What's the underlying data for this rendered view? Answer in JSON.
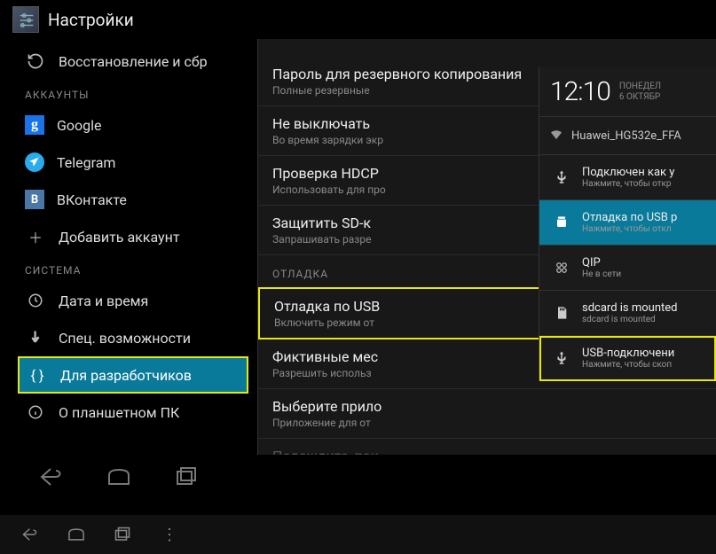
{
  "header": {
    "title": "Настройки"
  },
  "sidebar": {
    "restore": "Восстановление и сбр",
    "section_accounts": "АККАУНТЫ",
    "google": "Google",
    "telegram": "Telegram",
    "vk": "ВКонтакте",
    "add_account": "Добавить аккаунт",
    "section_system": "СИСТЕМА",
    "datetime": "Дата и время",
    "accessibility": "Спец. возможности",
    "developer": "Для разработчиков",
    "about": "О планшетном ПК"
  },
  "main": {
    "backup_pwd": {
      "pri": "Пароль для резервного копирования",
      "sec": "Полные резервные"
    },
    "stay_awake": {
      "pri": "Не выключать",
      "sec": "Во время зарядки экр"
    },
    "hdcp": {
      "pri": "Проверка HDCP",
      "sec": "Использовать для про"
    },
    "protect_sd": {
      "pri": "Защитить SD-к",
      "sec": "Запрашивать разре"
    },
    "section_debug": "ОТЛАДКА",
    "usb_debug": {
      "pri": "Отладка по USB",
      "sec": "Включить режим от"
    },
    "fake_loc": {
      "pri": "Фиктивные мес",
      "sec": "Разрешить использ"
    },
    "select_app": {
      "pri": "Выберите прило",
      "sec": "Приложение для от"
    },
    "wait_dbg": {
      "pri": "Подождите, пок"
    }
  },
  "notif": {
    "time": "12:10",
    "day": "ПОНЕДЕЛ",
    "date": "6 ОКТЯБР",
    "wifi": "Huawei_HG532e_FFA",
    "rows": [
      {
        "pri": "Подключен как у",
        "sec": "Нажмите, чтобы откр"
      },
      {
        "pri": "Отладка по USB р",
        "sec": "Нажмите, чтобы откл"
      },
      {
        "pri": "QIP",
        "sec": "Не в сети"
      },
      {
        "pri": "sdcard is mounted",
        "sec": "sdcard is mounted"
      },
      {
        "pri": "USB-подключени",
        "sec": "Нажмите, чтобы скоп"
      }
    ]
  }
}
